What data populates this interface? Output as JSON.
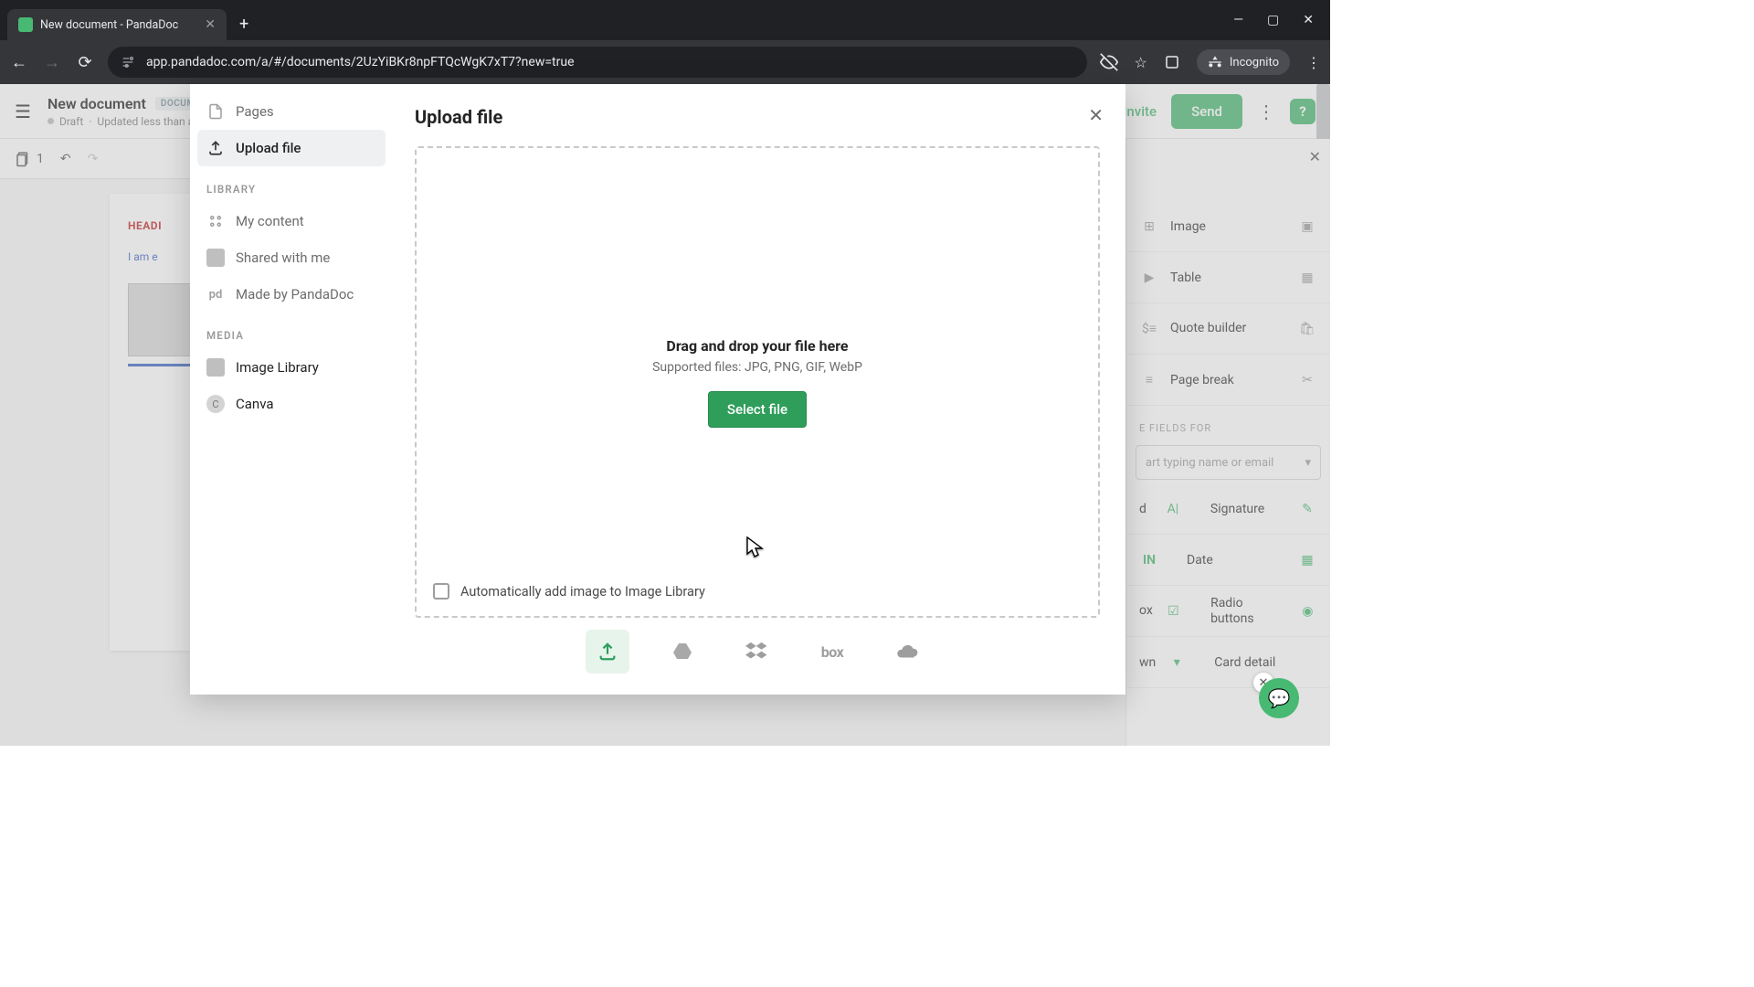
{
  "browser": {
    "tab_title": "New document - PandaDoc",
    "url": "app.pandadoc.com/a/#/documents/2UzYiBKr8npFTQcWgK7xT7?new=true",
    "incognito_label": "Incognito"
  },
  "header": {
    "doc_title": "New document",
    "badge": "DOCUMENTS",
    "status": "Draft",
    "updated": "Updated less than a minute ago",
    "invite": "Invite",
    "send": "Send"
  },
  "secbar": {
    "page_count": "1"
  },
  "doc_preview": {
    "heading": "HEADI",
    "text": "I am e"
  },
  "modal": {
    "title": "Upload file",
    "side": {
      "pages": "Pages",
      "upload": "Upload file",
      "library_label": "LIBRARY",
      "my_content": "My content",
      "shared": "Shared with me",
      "made_by": "Made by PandaDoc",
      "media_label": "MEDIA",
      "image_library": "Image Library",
      "canva": "Canva"
    },
    "drop": {
      "title": "Drag and drop your file here",
      "subtitle": "Supported files: JPG, PNG, GIF, WebP",
      "select": "Select file",
      "auto_add": "Automatically add image to Image Library"
    },
    "providers": {
      "box": "box"
    }
  },
  "right_panel": {
    "image": "Image",
    "table": "Table",
    "quote": "Quote builder",
    "pagebreak": "Page break",
    "fillable_label": "E FIELDS FOR",
    "name_placeholder": "art typing name or email",
    "field": "d",
    "signature": "Signature",
    "date": "Date",
    "checkbox": "ox",
    "radio": "Radio buttons",
    "dropdown": "wn",
    "card": "Card detail"
  }
}
